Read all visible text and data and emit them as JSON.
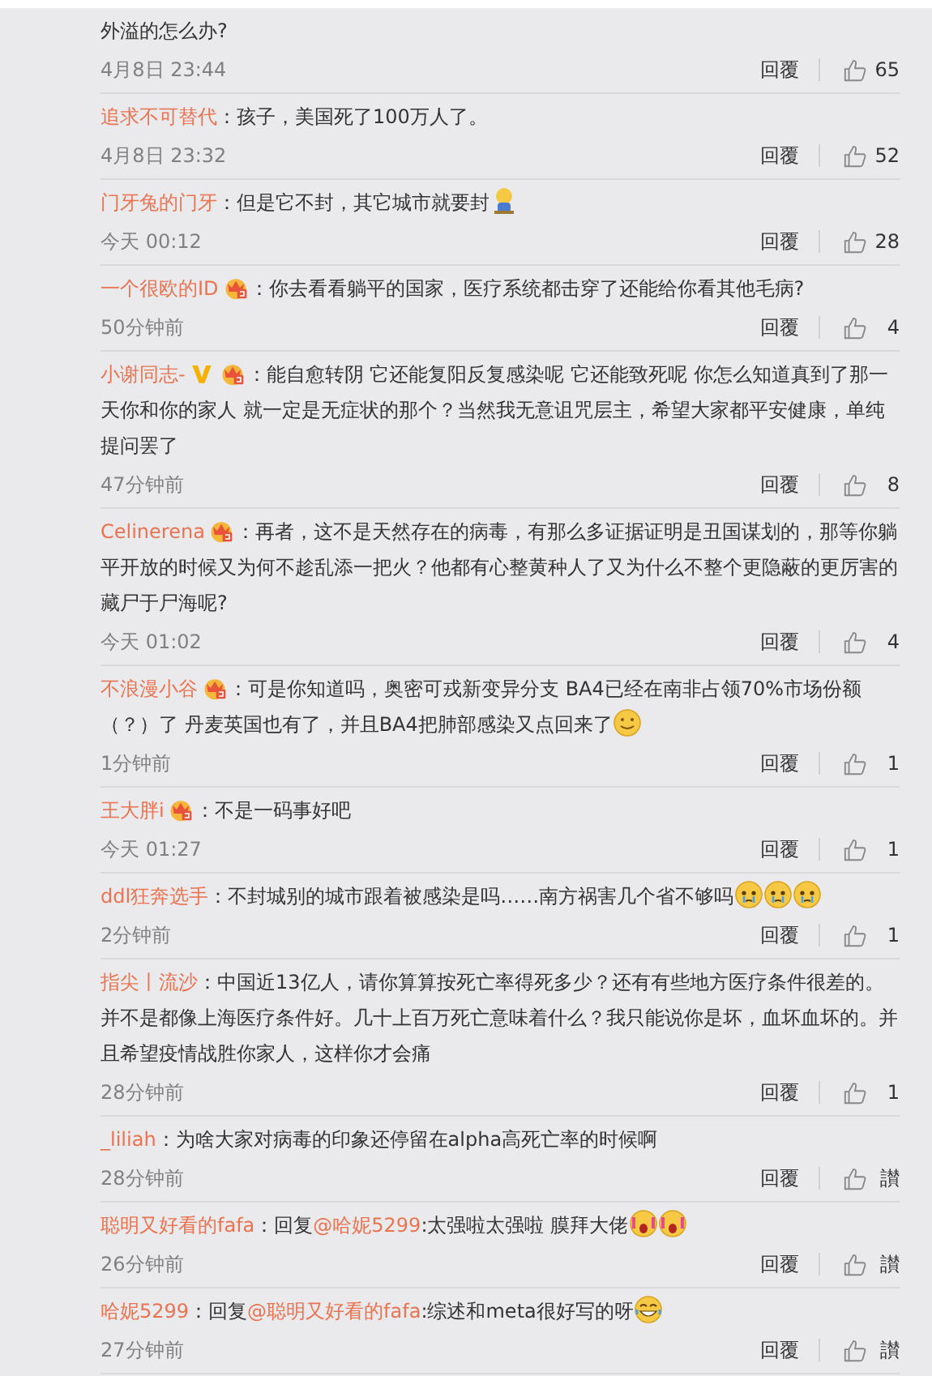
{
  "comments": [
    {
      "content": [
        {
          "kind": "text",
          "text": "外溢的怎么办?"
        }
      ],
      "time": "4月8日 23:44",
      "reply": "回覆",
      "likes": "65"
    },
    {
      "user": "追求不可替代",
      "separator": "：",
      "content": [
        {
          "kind": "text",
          "text": "孩子，美国死了100万人了。"
        }
      ],
      "time": "4月8日 23:32",
      "reply": "回覆",
      "likes": "52"
    },
    {
      "user": "门牙兔的门牙",
      "separator": "：",
      "content": [
        {
          "kind": "text",
          "text": "但是它不封，其它城市就要封"
        },
        {
          "kind": "sitting"
        }
      ],
      "time": "今天 00:12",
      "reply": "回覆",
      "likes": "28"
    },
    {
      "user": "一个很欧的ID",
      "separator": "：",
      "badges": [
        {
          "kind": "crown"
        }
      ],
      "content": [
        {
          "kind": "text",
          "text": "你去看看躺平的国家，医疗系统都击穿了还能给你看其他毛病?"
        }
      ],
      "time": "50分钟前",
      "reply": "回覆",
      "likes": "4"
    },
    {
      "user": "小谢同志-",
      "separator": "：",
      "badges": [
        {
          "kind": "vip"
        },
        {
          "kind": "crown"
        }
      ],
      "content": [
        {
          "kind": "text",
          "text": "能自愈转阴 它还能复阳反复感染呢 它还能致死呢 你怎么知道真到了那一天你和你的家人 就一定是无症状的那个？当然我无意诅咒层主，希望大家都平安健康，单纯提问罢了"
        }
      ],
      "time": "47分钟前",
      "reply": "回覆",
      "likes": "8"
    },
    {
      "user": "Celinerena",
      "separator": "：",
      "badges": [
        {
          "kind": "crown"
        }
      ],
      "content": [
        {
          "kind": "text",
          "text": "再者，这不是天然存在的病毒，有那么多证据证明是丑国谋划的，那等你躺平开放的时候又为何不趁乱添一把火？他都有心整黄种人了又为什么不整个更隐蔽的更厉害的藏尸于尸海呢?"
        }
      ],
      "time": "今天 01:02",
      "reply": "回覆",
      "likes": "4"
    },
    {
      "user": "不浪漫小谷",
      "separator": "：",
      "badges": [
        {
          "kind": "crown"
        }
      ],
      "content": [
        {
          "kind": "text",
          "text": "可是你知道吗，奥密可戎新变异分支 BA4已经在南非占领70%市场份额（？）了 丹麦英国也有了，并且BA4把肺部感染又点回来了"
        },
        {
          "kind": "smile"
        }
      ],
      "time": "1分钟前",
      "reply": "回覆",
      "likes": "1"
    },
    {
      "user": "王大胖i",
      "separator": "：",
      "badges": [
        {
          "kind": "crown"
        }
      ],
      "content": [
        {
          "kind": "text",
          "text": "不是一码事好吧"
        }
      ],
      "time": "今天 01:27",
      "reply": "回覆",
      "likes": "1"
    },
    {
      "user": "ddl狂奔选手",
      "separator": "：",
      "content": [
        {
          "kind": "text",
          "text": "不封城别的城市跟着被感染是吗……南方祸害几个省不够吗"
        },
        {
          "kind": "crying"
        },
        {
          "kind": "crying"
        },
        {
          "kind": "crying"
        }
      ],
      "time": "2分钟前",
      "reply": "回覆",
      "likes": "1"
    },
    {
      "user": "指尖丨流沙",
      "separator": "：",
      "content": [
        {
          "kind": "text",
          "text": "中国近13亿人，请你算算按死亡率得死多少？还有有些地方医疗条件很差的。并不是都像上海医疗条件好。几十上百万死亡意味着什么？我只能说你是坏，血坏血坏的。并且希望疫情战胜你家人，这样你才会痛"
        }
      ],
      "time": "28分钟前",
      "reply": "回覆",
      "likes": "1"
    },
    {
      "user": "_liliah",
      "separator": "：",
      "content": [
        {
          "kind": "text",
          "text": "为啥大家对病毒的印象还停留在alpha高死亡率的时候啊"
        }
      ],
      "time": "28分钟前",
      "reply": "回覆",
      "likes": "讃"
    },
    {
      "user": "聪明又好看的fafa",
      "separator": "：",
      "content": [
        {
          "kind": "text",
          "text": "回复"
        },
        {
          "kind": "mention",
          "text": "@哈妮5299"
        },
        {
          "kind": "text",
          "text": ":太强啦太强啦 膜拜大佬"
        },
        {
          "kind": "screaming"
        },
        {
          "kind": "screaming"
        }
      ],
      "time": "26分钟前",
      "reply": "回覆",
      "likes": "讃"
    },
    {
      "user": "哈妮5299",
      "separator": "：",
      "content": [
        {
          "kind": "text",
          "text": "回复"
        },
        {
          "kind": "mention",
          "text": "@聪明又好看的fafa"
        },
        {
          "kind": "text",
          "text": ":综述和meta很好写的呀"
        },
        {
          "kind": "laughing"
        }
      ],
      "time": "27分钟前",
      "reply": "回覆",
      "likes": "讃"
    }
  ]
}
